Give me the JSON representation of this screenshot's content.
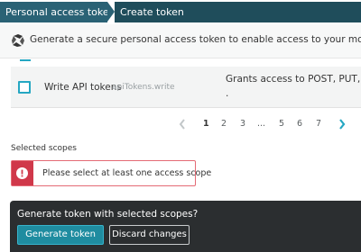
{
  "breadcrumb": {
    "items": [
      "Personal access tokens",
      "Create token"
    ]
  },
  "info": {
    "text": "Generate a secure personal access token to enable access to your monitoring data via Dy",
    "icon": "dynatrace-logo-icon"
  },
  "scope_row": {
    "title": "Write API tokens",
    "scope_id": "apiTokens.write",
    "description": "Grants access to POST, PUT, and DEL",
    "description_tail": ".",
    "checked": false
  },
  "pagination": {
    "pages": [
      "1",
      "2",
      "3",
      "...",
      "5",
      "6",
      "7"
    ],
    "current": "1"
  },
  "selected_scopes": {
    "label": "Selected scopes",
    "error": "Please select at least one access scope"
  },
  "footer": {
    "title": "Generate token with selected scopes?",
    "primary_label": "Generate token",
    "secondary_label": "Discard changes"
  },
  "colors": {
    "accent": "#25a7c2",
    "breadcrumb": "#2a6275",
    "error": "#d0384a",
    "footer_bg": "#2b2e30"
  }
}
